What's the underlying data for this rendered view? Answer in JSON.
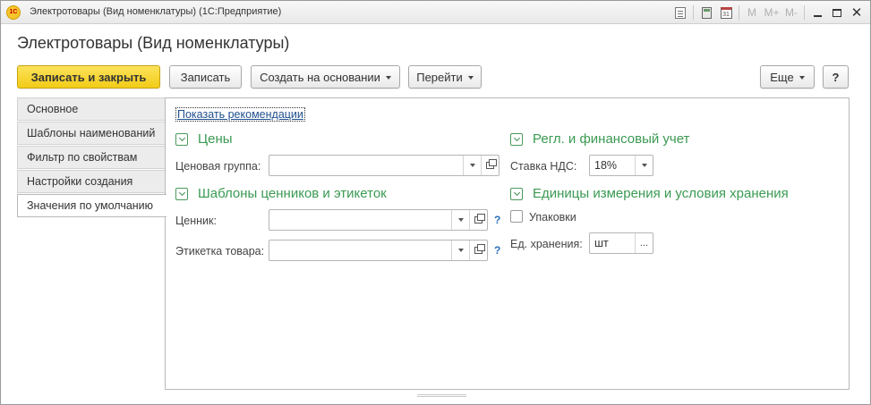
{
  "window": {
    "title": "Электротовары (Вид номенклатуры)  (1С:Предприятие)",
    "logo_text": "1С",
    "toolbar_icons": [
      "document-icon",
      "calculator-icon",
      "calendar-icon",
      "M",
      "M+",
      "M-",
      "minimize-icon",
      "maximize-icon",
      "close-icon"
    ],
    "calendar_day": "31",
    "memory_labels": [
      "M",
      "M+",
      "M-"
    ]
  },
  "form": {
    "title": "Электротовары (Вид номенклатуры)"
  },
  "toolbar": {
    "save_close_label": "Записать и закрыть",
    "save_label": "Записать",
    "create_based_label": "Создать на основании",
    "goto_label": "Перейти",
    "more_label": "Еще",
    "help_label": "?"
  },
  "nav": {
    "items": [
      {
        "label": "Основное",
        "active": false
      },
      {
        "label": "Шаблоны наименований",
        "active": false
      },
      {
        "label": "Фильтр по свойствам",
        "active": false
      },
      {
        "label": "Настройки создания",
        "active": false
      },
      {
        "label": "Значения по умолчанию",
        "active": true
      }
    ]
  },
  "content": {
    "show_recommendations": "Показать рекомендации",
    "prices": {
      "title": "Цены",
      "price_group_label": "Ценовая группа:",
      "price_group_value": ""
    },
    "labels": {
      "title": "Шаблоны ценников и этикеток",
      "price_tag_label": "Ценник:",
      "price_tag_value": "",
      "product_label_label": "Этикетка товара:",
      "product_label_value": "",
      "help": "?"
    },
    "accounting": {
      "title": "Регл. и финансовый учет",
      "vat_label": "Ставка НДС:",
      "vat_value": "18%"
    },
    "units": {
      "title": "Единицы измерения и условия хранения",
      "packages_label": "Упаковки",
      "packages_checked": false,
      "storage_unit_label": "Ед. хранения:",
      "storage_unit_value": "шт",
      "choose_button": "..."
    }
  },
  "colors": {
    "accent_green": "#3a9a52",
    "primary_button": "#f2cc18",
    "link": "#1f4f8f",
    "help": "#2a6fb6"
  }
}
